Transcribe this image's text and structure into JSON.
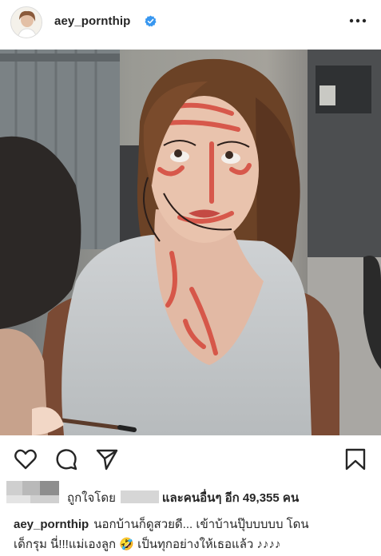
{
  "post": {
    "username": "aey_pornthip",
    "verified": true
  },
  "likes": {
    "liked_by_label": "ถูกใจโดย",
    "and_others_label": "และคนอื่นๆ อีก",
    "count": "49,355",
    "unit": "คน"
  },
  "caption": {
    "username": "aey_pornthip",
    "text_line1": "นอกบ้านก็ดูสวยดี... เข้าบ้านปุ๊บบบบบ โดน",
    "text_line2": "เด็กรุม นี่!!!แม่เองลูก 🤣 เป็นทุกอย่างให้เธอแล้ว ♪♪♪♪"
  },
  "colors": {
    "text": "#262626",
    "verified_blue": "#3897f0",
    "icon_stroke": "#262626"
  },
  "icons": [
    "verified-icon",
    "more-icon",
    "heart-icon",
    "comment-icon",
    "share-icon",
    "bookmark-icon"
  ]
}
